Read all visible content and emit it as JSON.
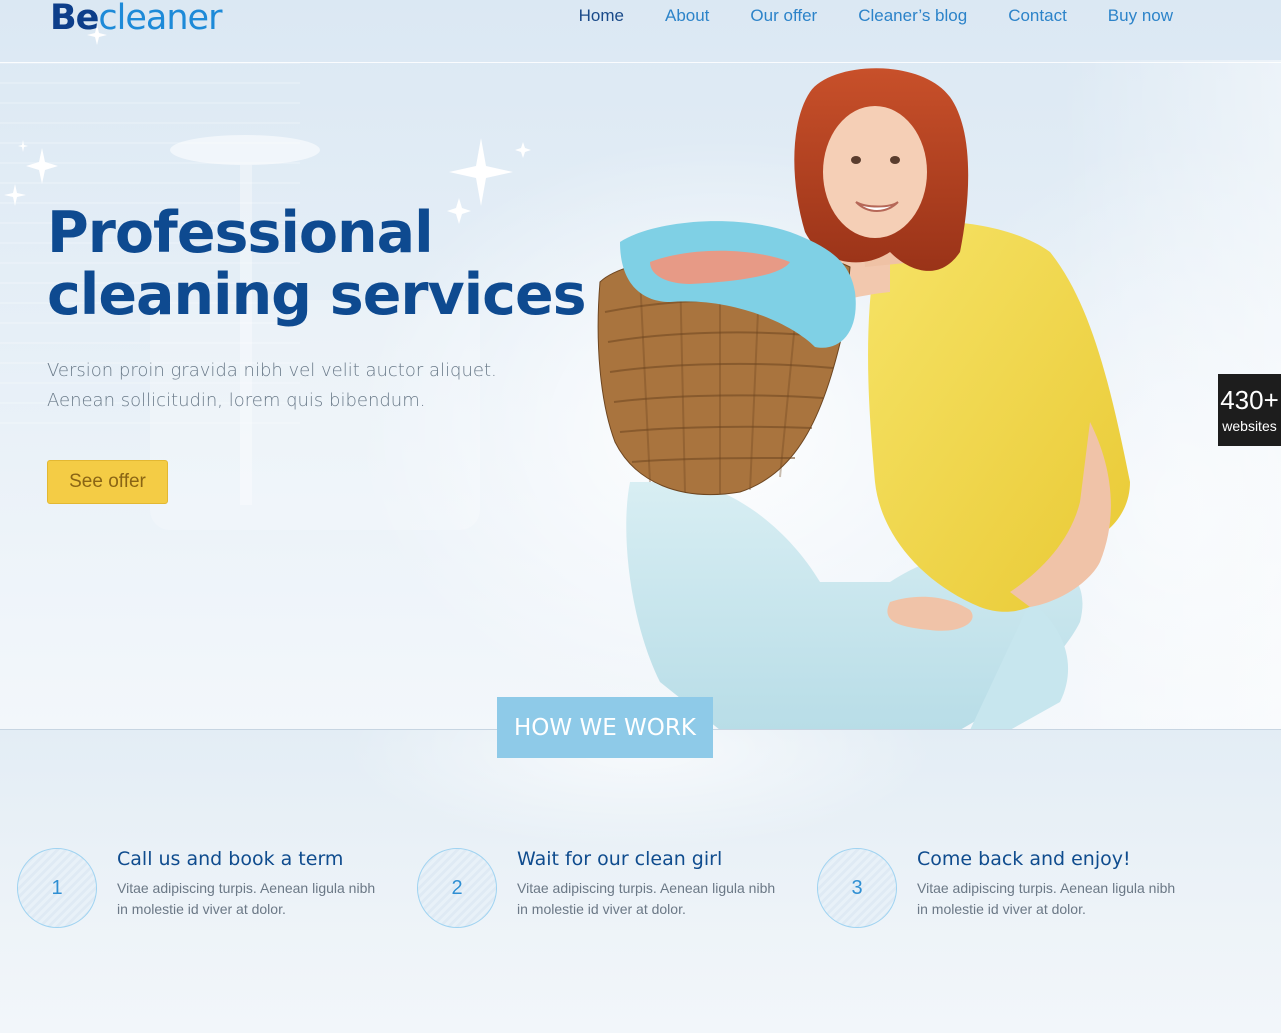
{
  "logo": {
    "part1": "Be",
    "part2": "cleaner"
  },
  "nav": {
    "items": [
      "Home",
      "About",
      "Our offer",
      "Cleaner’s blog",
      "Contact",
      "Buy now"
    ]
  },
  "hero": {
    "headline_line1": "Professional",
    "headline_line2": "cleaning services",
    "subtext_line1": "Version proin gravida nibh vel velit auctor aliquet.",
    "subtext_line2": "Aenean sollicitudin, lorem quis bibendum.",
    "cta_label": "See offer"
  },
  "how_we_work": {
    "tab_label": "HOW WE WORK",
    "steps": [
      {
        "number": "1",
        "title": "Call us and book a term",
        "desc": "Vitae adipiscing turpis. Aenean ligula nibh in molestie id viver at dolor."
      },
      {
        "number": "2",
        "title": "Wait for our clean girl",
        "desc": "Vitae adipiscing turpis. Aenean ligula nibh in molestie id viver at dolor."
      },
      {
        "number": "3",
        "title": "Come back and enjoy!",
        "desc": "Vitae adipiscing turpis. Aenean ligula nibh in molestie id viver at dolor."
      }
    ]
  },
  "badge": {
    "number": "430+",
    "label": "websites"
  },
  "colors": {
    "brand_dark": "#0d3e8a",
    "brand_light": "#1d8ad8",
    "cta_yellow": "#f4cc45",
    "tab_blue": "#8ecae8",
    "badge_bg": "#1d1d1d"
  },
  "icons": {
    "sparkle": "sparkle-icon"
  }
}
